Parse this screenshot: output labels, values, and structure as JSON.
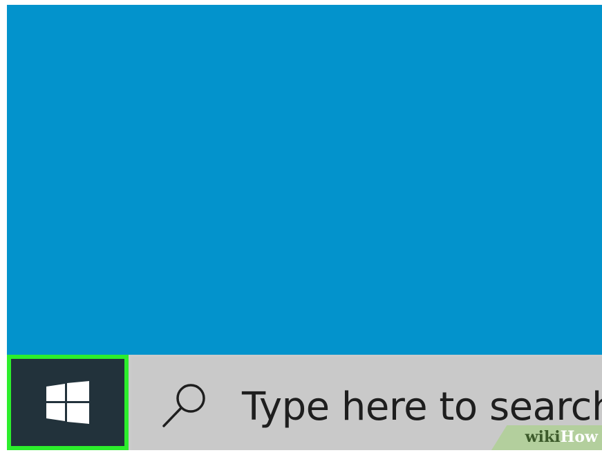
{
  "desktop": {
    "background_color": "#0393cc"
  },
  "taskbar": {
    "start_button": {
      "icon": "windows-logo-icon",
      "highlight_color": "#2cee2c",
      "background_color": "#22323b"
    },
    "search": {
      "icon": "search-icon",
      "placeholder": "Type here to search"
    }
  },
  "watermark": {
    "part1": "wiki",
    "part2": "How"
  }
}
